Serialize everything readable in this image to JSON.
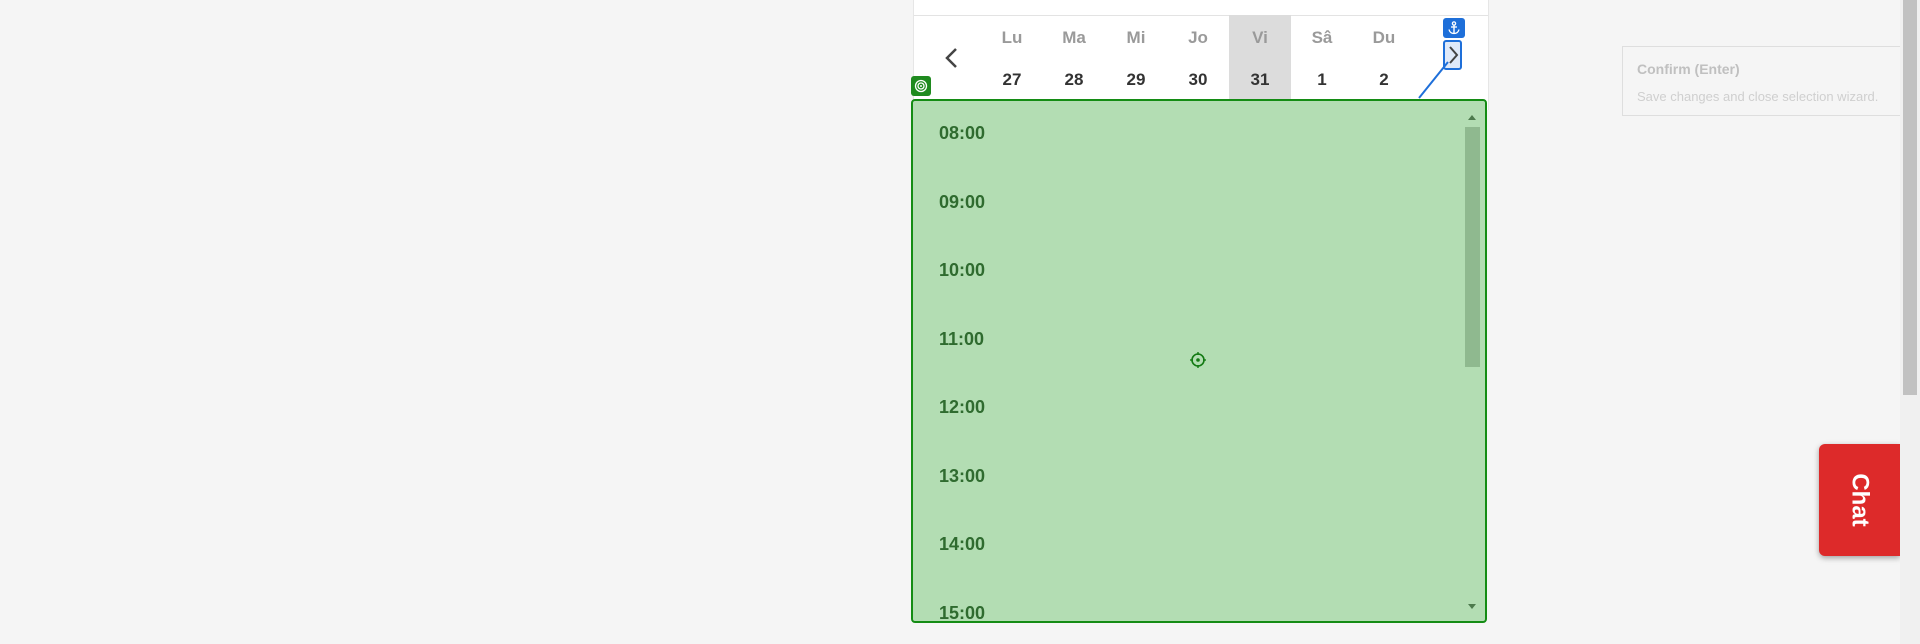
{
  "calendar": {
    "prev_icon": "chevron-left-icon",
    "next_icon": "chevron-right-icon",
    "days": [
      {
        "name": "Lu",
        "num": "27"
      },
      {
        "name": "Ma",
        "num": "28"
      },
      {
        "name": "Mi",
        "num": "29"
      },
      {
        "name": "Jo",
        "num": "30"
      },
      {
        "name": "Vi",
        "num": "31"
      },
      {
        "name": "Sâ",
        "num": "1"
      },
      {
        "name": "Du",
        "num": "2"
      }
    ],
    "selected_day_index": 4
  },
  "times": [
    "08:00",
    "09:00",
    "10:00",
    "11:00",
    "12:00",
    "13:00",
    "14:00",
    "15:00"
  ],
  "tooltip": {
    "title": "Confirm (Enter)",
    "description": "Save changes and close selection wizard."
  },
  "chat": {
    "label": "Chat"
  },
  "colors": {
    "overlay_fill": "#b3ddb3",
    "overlay_border": "#148c14",
    "anchor_blue": "#1e6fd9",
    "chat_red": "#dd2a2a"
  }
}
